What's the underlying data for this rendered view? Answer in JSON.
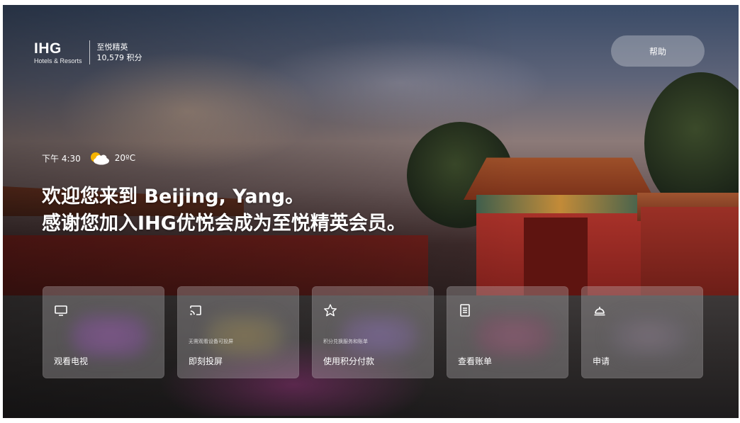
{
  "header": {
    "logo": {
      "main": "IHG",
      "sub": "Hotels & Resorts"
    },
    "member_tier": "至悦精英",
    "points": "10,579 积分",
    "help_label": "帮助"
  },
  "status": {
    "time": "下午 4:30",
    "weather_icon": "partly-cloudy-icon",
    "temperature": "20ºC"
  },
  "greeting": {
    "line1": "欢迎您来到 Beijing, Yang。",
    "line2": "感谢您加入IHG优悦会成为至悦精英会员。"
  },
  "cards": [
    {
      "icon": "tv-icon",
      "subtitle": "",
      "label": "观看电视"
    },
    {
      "icon": "cast-icon",
      "subtitle": "无需观看设备可投屏",
      "label": "即刻投屏"
    },
    {
      "icon": "star-icon",
      "subtitle": "积分兑换服务和账单",
      "label": "使用积分付款"
    },
    {
      "icon": "bill-icon",
      "subtitle": "",
      "label": "查看账单"
    },
    {
      "icon": "service-bell-icon",
      "subtitle": "",
      "label": "申请"
    }
  ],
  "colors": {
    "card_bg": "rgba(200,195,200,0.32)",
    "help_bg": "rgba(255,255,255,0.28)",
    "sun": "#f5b300",
    "text": "#ffffff"
  }
}
